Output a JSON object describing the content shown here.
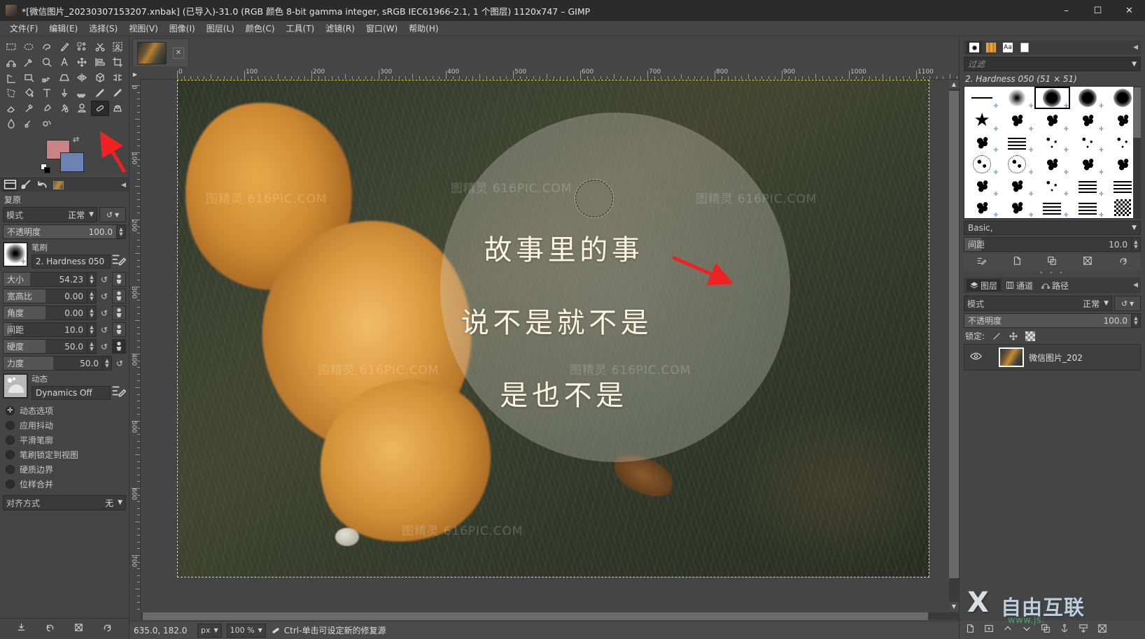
{
  "window": {
    "title": "*[微信图片_20230307153207.xnbak] (已导入)-31.0 (RGB 颜色 8-bit gamma integer, sRGB IEC61966-2.1, 1 个图层) 1120x747 – GIMP",
    "minimize": "–",
    "maximize": "☐",
    "close": "✕"
  },
  "menu": [
    {
      "label": "文件(F)"
    },
    {
      "label": "编辑(E)"
    },
    {
      "label": "选择(S)"
    },
    {
      "label": "视图(V)"
    },
    {
      "label": "图像(I)"
    },
    {
      "label": "图层(L)"
    },
    {
      "label": "颜色(C)"
    },
    {
      "label": "工具(T)"
    },
    {
      "label": "滤镜(R)"
    },
    {
      "label": "窗口(W)"
    },
    {
      "label": "帮助(H)"
    }
  ],
  "toolbox": {
    "tools": [
      "rect-select-icon",
      "ellipse-select-icon",
      "free-select-icon",
      "fuzzy-select-icon",
      "select-by-color-icon",
      "scissors-select-icon",
      "foreground-select-icon",
      "paths-icon",
      "color-picker-icon",
      "zoom-icon",
      "measure-icon",
      "move-icon",
      "alignment-icon",
      "crop-icon",
      "rotate-icon",
      "unified-transform-icon",
      "warp-transform-icon",
      "perspective-icon",
      "flip-icon",
      "3d-transform-icon",
      "handle-transform-icon",
      "cage-transform-icon",
      "bucket-fill-icon",
      "text-icon",
      "gradient-icon",
      "dither-icon",
      "pencil-icon",
      "paintbrush-icon",
      "eraser-icon",
      "airbrush-icon",
      "ink-icon",
      "mypaint-brush-icon",
      "clone-icon",
      "heal-icon",
      "perspective-clone-icon",
      "blur-sharpen-icon",
      "smudge-icon",
      "dodge-burn-icon"
    ],
    "active_tool": "heal-icon",
    "foreground_color": "#c98585",
    "background_color": "#6b82b5",
    "swap_icon": "swap-colors-icon",
    "default_colors_icon": "default-colors-icon"
  },
  "tool_options": {
    "tabs": [
      "tool-options-tab",
      "device-status-tab",
      "undo-history-tab",
      "images-tab"
    ],
    "active_tab_index": 0,
    "collapse_icon": "◀",
    "title": "复原",
    "mode": {
      "label": "模式",
      "value": "正常"
    },
    "reset_icon": "↺",
    "opacity": {
      "label": "不透明度",
      "value": "100.0",
      "fill_pct": 100
    },
    "brush": {
      "caption": "笔刷",
      "name": "2. Hardness 050",
      "edit_icon": "edit-brush-icon"
    },
    "size": {
      "label": "大小",
      "value": "54.23",
      "fill_pct": 32
    },
    "aspect": {
      "label": "宽高比",
      "value": "0.00",
      "fill_pct": 50
    },
    "angle": {
      "label": "角度",
      "value": "0.00",
      "fill_pct": 50
    },
    "spacing": {
      "label": "间距",
      "value": "10.0",
      "fill_pct": 10
    },
    "hardness": {
      "label": "硬度",
      "value": "50.0",
      "fill_pct": 50
    },
    "force": {
      "label": "力度",
      "value": "50.0",
      "fill_pct": 50
    },
    "dynamics": {
      "caption": "动态",
      "name": "Dynamics Off",
      "edit_icon": "edit-dynamics-icon"
    },
    "checkboxes": [
      {
        "label": "动态选项",
        "checked": true
      },
      {
        "label": "应用抖动",
        "checked": false
      },
      {
        "label": "平滑笔廓",
        "checked": false
      },
      {
        "label": "笔刷锁定到视图",
        "checked": false
      },
      {
        "label": "硬质边界",
        "checked": false
      },
      {
        "label": "位样合并",
        "checked": false
      }
    ],
    "align": {
      "label": "对齐方式",
      "value": "无"
    },
    "footer_icons": [
      "save-options-icon",
      "restore-options-icon",
      "delete-options-icon",
      "reset-options-icon"
    ]
  },
  "image_tab": {
    "close_icon": "✕",
    "thumbnail": "image-thumbnail"
  },
  "rulers": {
    "h_labels": [
      "0",
      "100",
      "200",
      "300",
      "400",
      "500",
      "600",
      "700",
      "800",
      "900",
      "1000",
      "1100"
    ],
    "v_labels": [
      "0",
      "100",
      "200",
      "300",
      "400",
      "500",
      "600",
      "700"
    ]
  },
  "canvas": {
    "poem_line1": "故事里的事",
    "poem_line2": "说不是就不是",
    "poem_line3": "是也不是",
    "watermarks": [
      "图精灵 616PIC.COM",
      "图精灵 616PIC.COM",
      "图精灵 616PIC.COM",
      "图精灵 616PIC.COM",
      "图精灵 616PIC.COM",
      "图精灵 616PIC.COM"
    ]
  },
  "statusbar": {
    "position": "635.0, 182.0",
    "unit": "px",
    "zoom": "100 %",
    "tool_icon": "heal-icon",
    "message": "Ctrl-单击可设定新的修复源"
  },
  "brushes_panel": {
    "tabs": [
      "brushes-tab",
      "patterns-tab",
      "fonts-tab",
      "documents-tab"
    ],
    "active_tab_index": 0,
    "collapse_icon": "◀",
    "filter_placeholder": "过滤",
    "selected_brush": "2. Hardness 050 (51 × 51)",
    "tag_group": "Basic,",
    "spacing": {
      "label": "间距",
      "value": "10.0",
      "fill_pct": 10
    },
    "action_icons": [
      "edit-brush-icon",
      "new-brush-icon",
      "duplicate-brush-icon",
      "delete-brush-icon",
      "refresh-brushes-icon"
    ]
  },
  "layers_panel": {
    "tabs": [
      {
        "label": "图层",
        "icon": "layers-icon"
      },
      {
        "label": "通道",
        "icon": "channels-icon"
      },
      {
        "label": "路径",
        "icon": "paths-icon"
      }
    ],
    "active_tab_index": 0,
    "collapse_icon": "◀",
    "mode": {
      "label": "模式",
      "value": "正常"
    },
    "reset_icon": "↺",
    "opacity": {
      "label": "不透明度",
      "value": "100.0",
      "fill_pct": 100
    },
    "lock_label": "锁定:",
    "lock_icons": [
      "lock-pixels-icon",
      "lock-position-icon",
      "lock-alpha-icon"
    ],
    "layer": {
      "name": "微信图片_202",
      "visible_icon": "eye-icon"
    },
    "buttons": [
      "new-layer-icon",
      "new-group-icon",
      "raise-layer-icon",
      "lower-layer-icon",
      "duplicate-layer-icon",
      "anchor-layer-icon",
      "merge-down-icon",
      "delete-layer-icon"
    ]
  },
  "branding": {
    "mark": "X",
    "name": "自由互联",
    "url": "www.js."
  }
}
